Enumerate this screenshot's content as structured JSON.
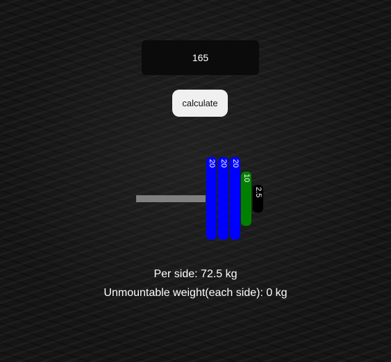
{
  "input": {
    "value": "165"
  },
  "button": {
    "label": "calculate"
  },
  "barbell": {
    "bar_color": "#808080",
    "plates": [
      {
        "label": "20",
        "weight": 20,
        "color": "#0000ff"
      },
      {
        "label": "20",
        "weight": 20,
        "color": "#0000ff"
      },
      {
        "label": "20",
        "weight": 20,
        "color": "#0000ff"
      },
      {
        "label": "10",
        "weight": 10,
        "color": "#008000"
      },
      {
        "label": "2.5",
        "weight": 2.5,
        "color": "#000000"
      }
    ]
  },
  "results": {
    "per_side": "Per side: 72.5 kg",
    "unmountable": "Unmountable weight(each side): 0 kg"
  }
}
